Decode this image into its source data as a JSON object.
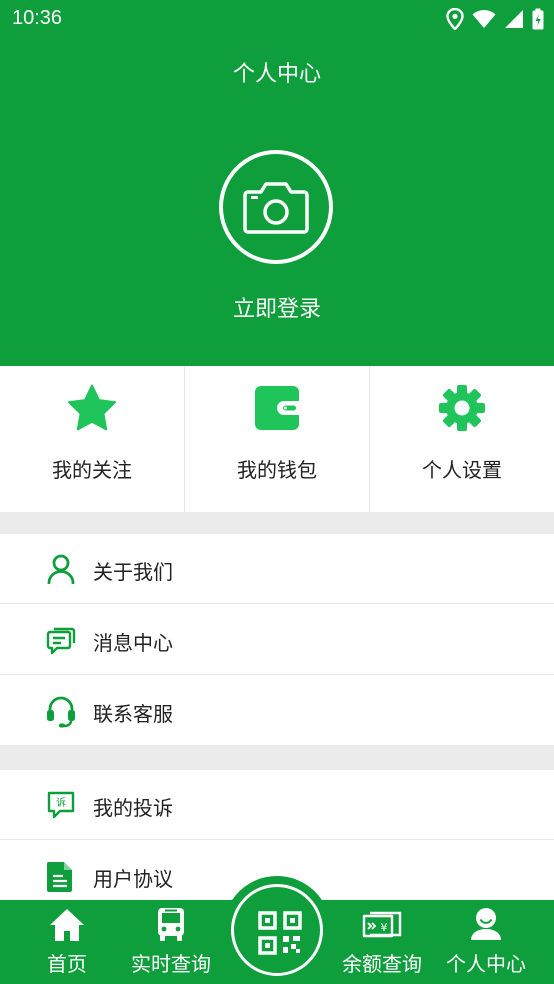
{
  "status_bar": {
    "time": "10:36",
    "icons": [
      "location-icon",
      "wifi-icon",
      "signal-icon",
      "battery-icon"
    ]
  },
  "header": {
    "title": "个人中心",
    "login_label": "立即登录",
    "background": "#0f9e3c"
  },
  "shortcuts": [
    {
      "label": "我的关注",
      "icon": "star-icon"
    },
    {
      "label": "我的钱包",
      "icon": "wallet-icon"
    },
    {
      "label": "个人设置",
      "icon": "gear-icon"
    }
  ],
  "menu_group1": [
    {
      "label": "关于我们",
      "icon": "user-icon"
    },
    {
      "label": "消息中心",
      "icon": "message-icon"
    },
    {
      "label": "联系客服",
      "icon": "headset-icon"
    }
  ],
  "menu_group2": [
    {
      "label": "我的投诉",
      "icon": "complaint-icon"
    },
    {
      "label": "用户协议",
      "icon": "document-icon"
    }
  ],
  "tabbar": {
    "tabs": [
      {
        "label": "首页",
        "icon": "home-icon"
      },
      {
        "label": "实时查询",
        "icon": "bus-icon"
      },
      {
        "label": "余额查询",
        "icon": "ticket-icon"
      },
      {
        "label": "个人中心",
        "icon": "person-icon"
      }
    ],
    "center_icon": "qr-code-icon"
  },
  "colors": {
    "accent": "#0f9e3c",
    "icon_green": "#1fc45a"
  }
}
